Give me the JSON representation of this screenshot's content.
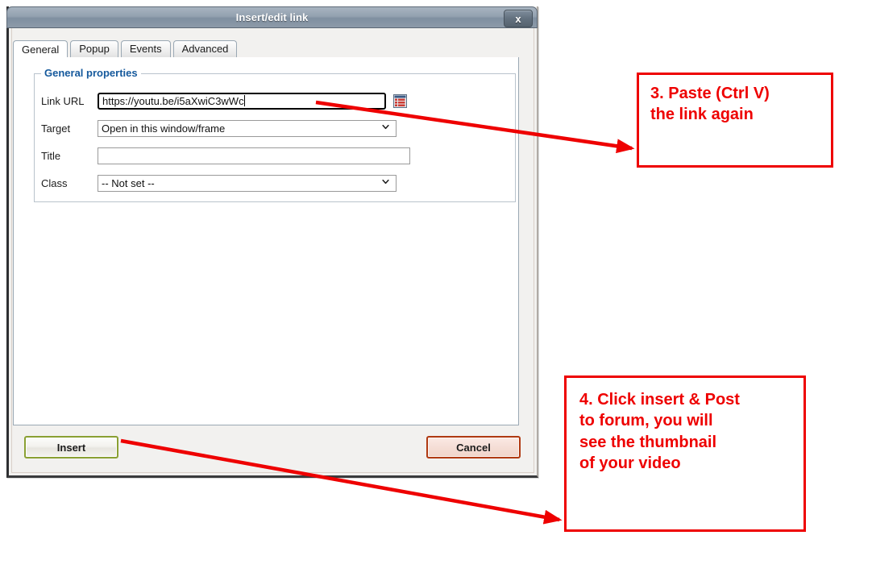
{
  "dialog": {
    "title": "Insert/edit link",
    "close_icon_label": "x",
    "tabs": [
      {
        "label": "General",
        "active": true
      },
      {
        "label": "Popup",
        "active": false
      },
      {
        "label": "Events",
        "active": false
      },
      {
        "label": "Advanced",
        "active": false
      }
    ],
    "fieldset": {
      "legend": "General properties",
      "fields": [
        {
          "label": "Link URL",
          "type": "text",
          "value": "https://youtu.be/i5aXwiC3wWc",
          "focused": true,
          "has_browse_icon": true
        },
        {
          "label": "Target",
          "type": "select",
          "value": "Open in this window/frame"
        },
        {
          "label": "Title",
          "type": "text",
          "value": ""
        },
        {
          "label": "Class",
          "type": "select",
          "value": "-- Not set --"
        }
      ]
    },
    "buttons": {
      "insert": "Insert",
      "cancel": "Cancel"
    },
    "icons": {
      "browse": "browse-list-icon",
      "close": "close-icon",
      "dropdown": "chevron-down-icon"
    }
  },
  "annotations": {
    "accent_color": "#ee0000",
    "paste_step": {
      "line1": "3. Paste (Ctrl V)",
      "line2": "the link again"
    },
    "insert_step": {
      "line1": "4. Click insert & Post",
      "line2": "to forum, you will",
      "line3": "see the thumbnail",
      "line4": "of your video"
    }
  }
}
